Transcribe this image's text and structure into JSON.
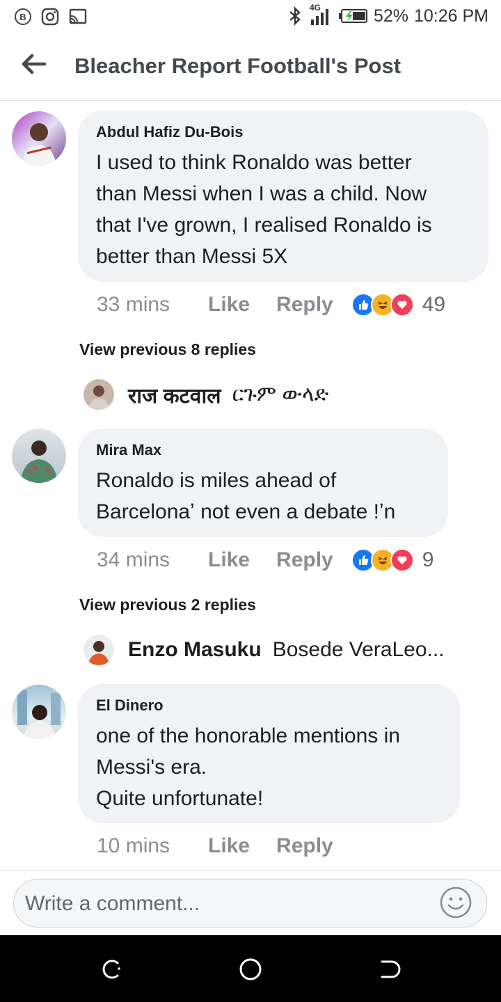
{
  "status_bar": {
    "network": "4G",
    "battery": "52%",
    "time": "10:26 PM",
    "icons": [
      "bereal-icon",
      "instagram-icon",
      "cast-icon",
      "bluetooth-icon",
      "signal-icon",
      "battery-icon"
    ]
  },
  "header": {
    "title": "Bleacher Report Football's Post"
  },
  "comments": [
    {
      "author": "Abdul Hafiz Du-Bois",
      "text": "I used to think Ronaldo was better\nthan Messi when I was a child. Now\nthat I've grown, I realised Ronaldo is\nbetter than Messi 5X",
      "time": "33 mins",
      "like": "Like",
      "reply": "Reply",
      "reaction_count": "49",
      "view_previous": "View previous 8 replies",
      "last_reply": {
        "name": "राज कटवाल",
        "text": "ርጉም ውላድ"
      }
    },
    {
      "author": "Mira Max",
      "text": "Ronaldo is miles ahead of\nBarcelonaʼ not even a debate !ʼn",
      "time": "34 mins",
      "like": "Like",
      "reply": "Reply",
      "reaction_count": "9",
      "view_previous": "View previous 2 replies",
      "last_reply": {
        "name": "Enzo Masuku",
        "text": "Bosede VeraLeo..."
      }
    },
    {
      "author": "El Dinero",
      "text": "one of the honorable mentions in\nMessi's era.\nQuite unfortunate!",
      "time": "10 mins",
      "like": "Like",
      "reply": "Reply"
    }
  ],
  "composer": {
    "placeholder": "Write a comment..."
  },
  "colors": {
    "bubble": "#f0f2f5",
    "meta_text": "#8a8d91",
    "like_blue": "#1877f2",
    "love_red": "#f33e58",
    "haha_yellow": "#f7b125"
  }
}
